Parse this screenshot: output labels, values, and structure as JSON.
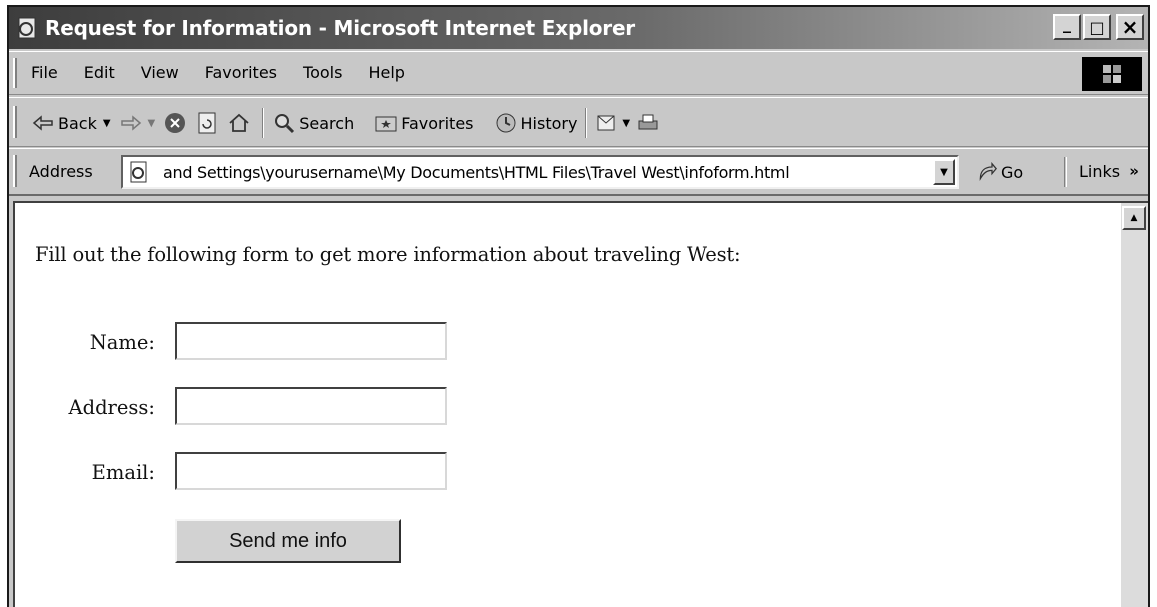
{
  "window": {
    "title": "Request for Information - Microsoft Internet Explorer",
    "minimize": "_",
    "maximize": "□",
    "close": "×"
  },
  "menu": [
    "File",
    "Edit",
    "View",
    "Favorites",
    "Tools",
    "Help"
  ],
  "toolbar": {
    "back": "Back",
    "search": "Search",
    "favorites": "Favorites",
    "history": "History"
  },
  "address": {
    "label": "Address",
    "value": "and Settings\\yourusername\\My Documents\\HTML Files\\Travel West\\infoform.html",
    "go": "Go",
    "links": "Links",
    "links_more": "»"
  },
  "page": {
    "intro": "Fill out the following form to get more information about traveling West:",
    "fields": [
      {
        "label": "Name:",
        "value": ""
      },
      {
        "label": "Address:",
        "value": ""
      },
      {
        "label": "Email:",
        "value": ""
      }
    ],
    "submit_label": "Send me info"
  }
}
